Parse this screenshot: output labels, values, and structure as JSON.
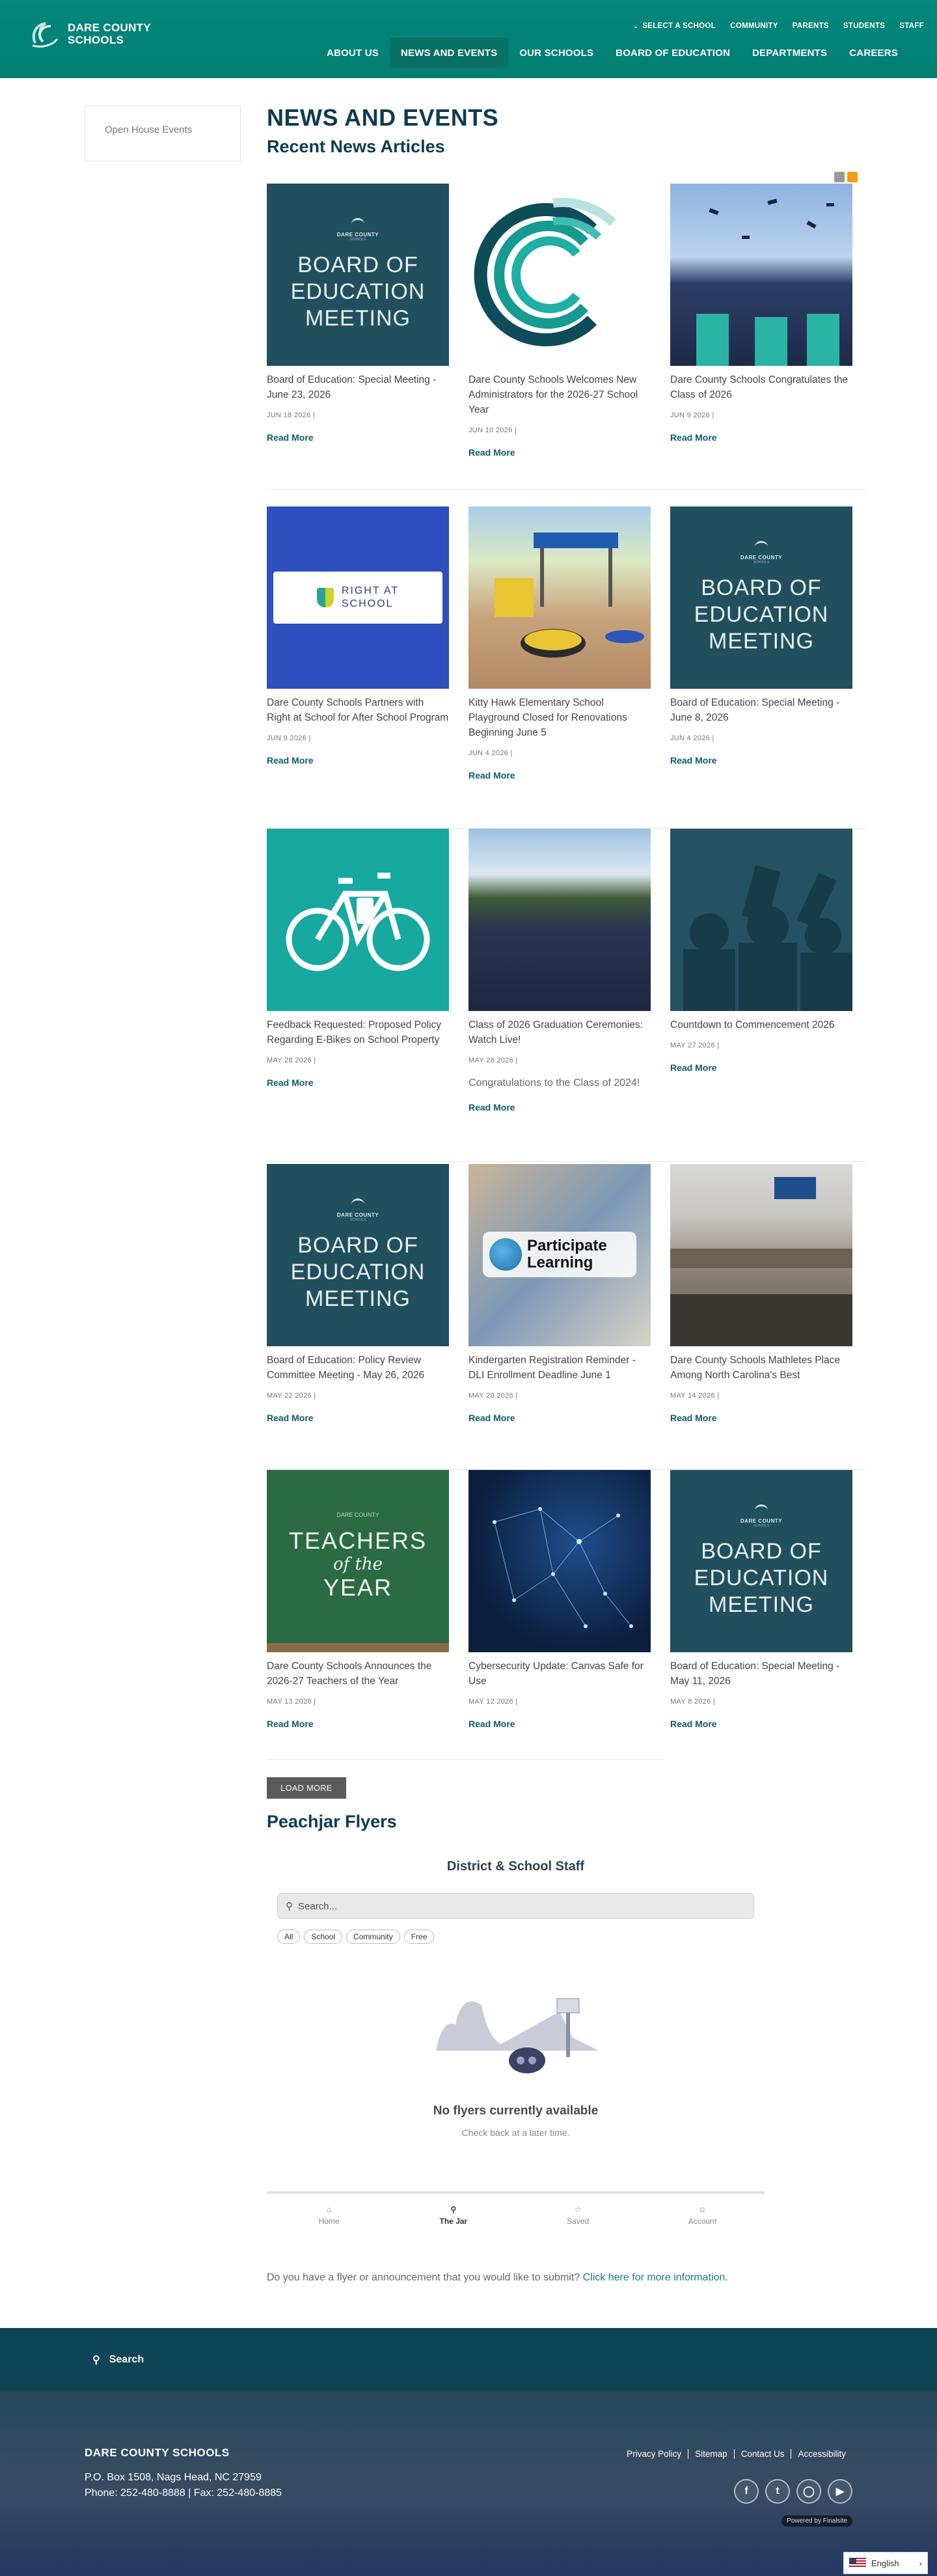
{
  "header": {
    "logo_line1": "DARE COUNTY",
    "logo_line2": "SCHOOLS",
    "utility": [
      "SELECT A SCHOOL",
      "COMMUNITY",
      "PARENTS",
      "STUDENTS",
      "STAFF"
    ],
    "nav": [
      "ABOUT US",
      "NEWS AND EVENTS",
      "OUR SCHOOLS",
      "BOARD OF EDUCATION",
      "DEPARTMENTS",
      "CAREERS"
    ]
  },
  "sidebar": {
    "item": "Open House Events"
  },
  "main": {
    "page_title": "NEWS AND EVENTS",
    "section_title": "Recent News Articles",
    "read_more": "Read More",
    "board_tile": {
      "small1": "DARE COUNTY",
      "small2": "SCHOOLS",
      "line1": "BOARD OF",
      "line2": "EDUCATION",
      "line3": "MEETING"
    },
    "teachers_tile": {
      "line1": "TEACHERS",
      "line2": "of the",
      "line3": "YEAR",
      "small": "DARE COUNTY"
    },
    "participate_tile": {
      "line1": "Participate",
      "line2": "Learning"
    },
    "right_at_school_tile": {
      "line1": "RIGHT AT",
      "line2": "SCHOOL"
    },
    "articles": [
      {
        "title": "Board of Education: Special Meeting - June 23, 2026",
        "date": "JUN 18 2026 |"
      },
      {
        "title": "Dare County Schools Welcomes New Administrators for the 2026-27 School Year",
        "date": "JUN 10 2026 |"
      },
      {
        "title": "Dare County Schools Congratulates the Class of 2026",
        "date": "JUN 9 2026 |"
      },
      {
        "title": "Dare County Schools Partners with Right at School for After School Program",
        "date": "JUN 9 2026 |"
      },
      {
        "title": "Kitty Hawk Elementary School Playground Closed for Renovations Beginning June 5",
        "date": "JUN 4 2026 |"
      },
      {
        "title": "Board of Education: Special Meeting - June 8, 2026",
        "date": "JUN 4 2026 |"
      },
      {
        "title": "Feedback Requested: Proposed Policy Regarding E-Bikes on School Property",
        "date": "MAY 28 2026 |"
      },
      {
        "title": "Class of 2026 Graduation Ceremonies: Watch Live!",
        "date": "MAY 28 2026 |",
        "excerpt": "Congratulations to the Class of 2024!"
      },
      {
        "title": "Countdown to Commencement 2026",
        "date": "MAY 27 2026 |"
      },
      {
        "title": "Board of Education: Policy Review Committee Meeting - May 26, 2026",
        "date": "MAY 22 2026 |"
      },
      {
        "title": "Kindergarten Registration Reminder - DLI Enrollment Deadline June 1",
        "date": "MAY 20 2026 |"
      },
      {
        "title": "Dare County Schools Mathletes Place Among North Carolina's Best",
        "date": "MAY 14 2026 |"
      },
      {
        "title": "Dare County Schools Announces the 2026-27 Teachers of the Year",
        "date": "MAY 13 2026 |"
      },
      {
        "title": "Cybersecurity Update: Canvas Safe for Use",
        "date": "MAY 12 2026 |"
      },
      {
        "title": "Board of Education: Special Meeting - May 11, 2026",
        "date": "MAY 8 2026 |"
      }
    ],
    "load_more": "LOAD MORE"
  },
  "peachjar": {
    "title": "Peachjar Flyers",
    "widget_title": "District & School Staff",
    "search_placeholder": "Search...",
    "chips": [
      "All",
      "School",
      "Community",
      "Free"
    ],
    "empty_title": "No flyers currently available",
    "empty_sub": "Check back at a later time.",
    "tabs": [
      "Home",
      "The Jar",
      "Saved",
      "Account"
    ],
    "submit_text": "Do you have a flyer or announcement that you would like to submit?",
    "submit_link": "Click here for more information."
  },
  "footer": {
    "search_label": "Search",
    "name": "DARE COUNTY SCHOOLS",
    "address": "P.O. Box 1508, Nags Head, NC 27959",
    "phone": "Phone: 252-480-8888",
    "fax": "Fax: 252-480-8885",
    "links": [
      "Privacy Policy",
      "Sitemap",
      "Contact Us",
      "Accessibility"
    ],
    "powered": "Powered by Finalsite",
    "language": "English"
  },
  "colors": {
    "brand": "#00867a",
    "navy": "#0f3b52",
    "board_tile": "#214f5e"
  }
}
